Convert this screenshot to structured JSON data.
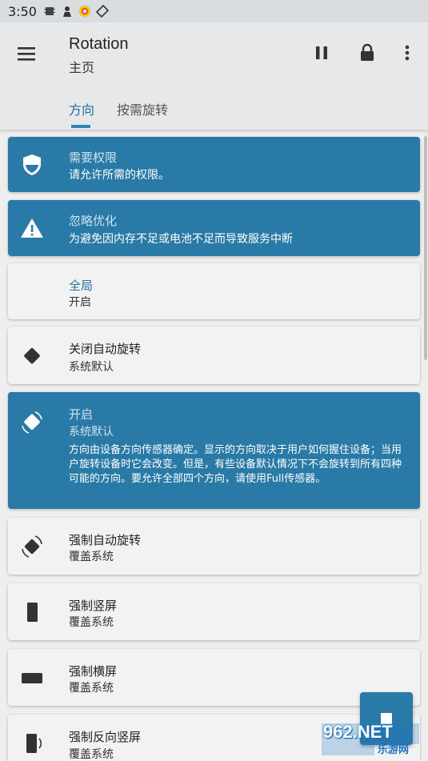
{
  "status_bar": {
    "time": "3:50"
  },
  "app_bar": {
    "title": "Rotation",
    "subtitle": "主页",
    "tabs": [
      {
        "label": "方向",
        "active": true
      },
      {
        "label": "按需旋转",
        "active": false
      }
    ]
  },
  "cards": [
    {
      "id": "permission",
      "title": "需要权限",
      "subtitle": "请允许所需的权限。",
      "icon": "shield-icon",
      "style": "blue"
    },
    {
      "id": "optimization",
      "title": "忽略优化",
      "subtitle": "为避免因内存不足或电池不足而导致服务中断",
      "icon": "warning-icon",
      "style": "blue"
    },
    {
      "id": "global",
      "title": "全局",
      "subtitle": "开启",
      "icon": "",
      "style": "plain"
    },
    {
      "id": "auto-rotate-off",
      "title": "关闭自动旋转",
      "subtitle": "系统默认",
      "icon": "device-landscape-icon",
      "style": "plain"
    },
    {
      "id": "auto-rotate-on",
      "title": "开启",
      "subtitle": "系统默认",
      "icon": "screen-rotation-icon",
      "style": "blue",
      "description": "方向由设备方向传感器确定。显示的方向取决于用户如何握住设备；当用户旋转设备时它会改变。但是，有些设备默认情况下不会旋转到所有四种可能的方向。要允许全部四个方向，请使用Full传感器。"
    },
    {
      "id": "force-auto-rotate",
      "title": "强制自动旋转",
      "subtitle": "覆盖系统",
      "icon": "screen-rotation-icon",
      "style": "plain"
    },
    {
      "id": "force-portrait",
      "title": "强制竖屏",
      "subtitle": "覆盖系统",
      "icon": "portrait-icon",
      "style": "plain"
    },
    {
      "id": "force-landscape",
      "title": "强制横屏",
      "subtitle": "覆盖系统",
      "icon": "landscape-icon",
      "style": "plain"
    },
    {
      "id": "force-reverse-portrait",
      "title": "强制反向竖屏",
      "subtitle": "覆盖系统",
      "icon": "reverse-portrait-icon",
      "style": "plain"
    }
  ],
  "watermark": {
    "line1": "962.NET",
    "line2": "乐游网"
  },
  "colors": {
    "accent": "#2a7aa8",
    "app_bar": "#e6e8ea",
    "background": "#eeeeee"
  }
}
